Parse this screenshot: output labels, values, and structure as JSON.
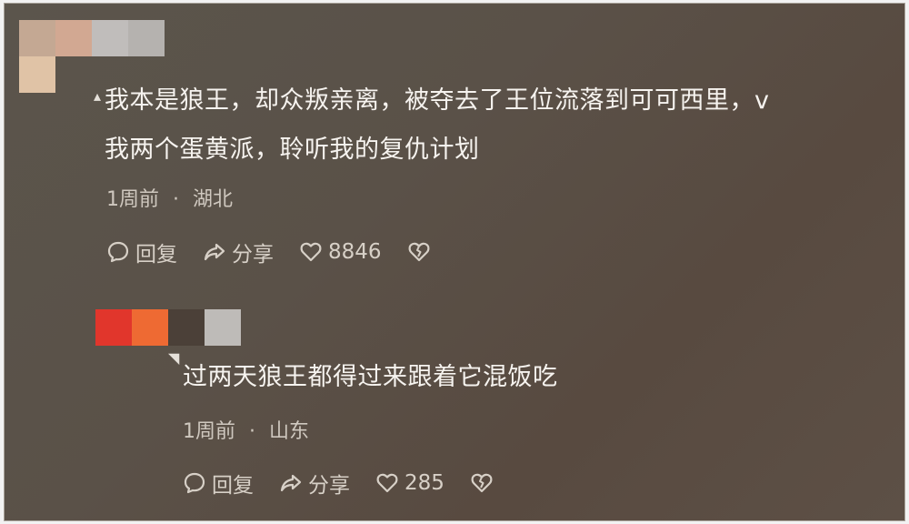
{
  "comments": [
    {
      "text_line1": "我本是狼王，却众叛亲离，被夺去了王位流落到可可西里，v",
      "text_line2": "我两个蛋黄派，聆听我的复仇计划",
      "time": "1周前",
      "location": "湖北",
      "reply_label": "回复",
      "share_label": "分享",
      "likes": "8846"
    },
    {
      "text_line1": "过两天狼王都得过来跟着它混饭吃",
      "time": "1周前",
      "location": "山东",
      "reply_label": "回复",
      "share_label": "分享",
      "likes": "285"
    }
  ],
  "separator": "·",
  "icons": [
    "comment-bubble-icon",
    "share-arrow-icon",
    "heart-icon",
    "broken-heart-icon"
  ],
  "colors": {
    "background": "#5a5148",
    "text": "#f6f3ef",
    "meta": "#cfc8bf"
  }
}
